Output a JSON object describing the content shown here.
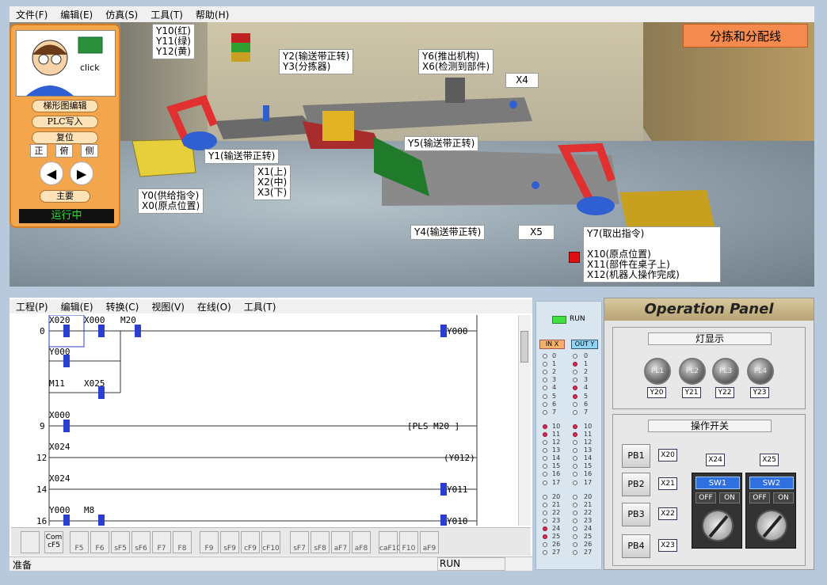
{
  "menu": [
    "文件(F)",
    "编辑(E)",
    "仿真(S)",
    "工具(T)",
    "帮助(H)"
  ],
  "scene": {
    "title": "分拣和分配线",
    "labels": {
      "y10": "Y10(红)\nY11(绿)\nY12(黄)",
      "y2": "Y2(输送带正转)\nY3(分拣器)",
      "y6": "Y6(推出机构)\nX6(检测到部件)",
      "x4": "X4",
      "y1": "Y1(输送带正转)",
      "x1": "X1(上)\nX2(中)\nX3(下)",
      "y0": "Y0(供给指令)\nX0(原点位置)",
      "y5": "Y5(输送带正转)",
      "y4": "Y4(输送带正转)",
      "x5": "X5",
      "y7": "Y7(取出指令)\n\nX10(原点位置)\nX11(部件在桌子上)\nX12(机器人操作完成)"
    }
  },
  "control": {
    "click": "click",
    "buttons": [
      "梯形图编辑",
      "PLC写入",
      "复位"
    ],
    "views": [
      "正",
      "俯",
      "侧"
    ],
    "main": "主要",
    "status": "运行中"
  },
  "editor": {
    "menu": [
      "工程(P)",
      "编辑(E)",
      "转换(C)",
      "视图(V)",
      "在线(O)",
      "工具(T)"
    ],
    "rungs": [
      {
        "step": "0",
        "contacts": [
          "X020",
          "X000",
          "M20"
        ],
        "coil": "Y000"
      },
      {
        "contacts": [
          "Y000"
        ]
      },
      {
        "contacts": [
          "M11",
          "X025"
        ]
      },
      {
        "step": "9",
        "contacts": [
          "X000"
        ],
        "coil": "[PLS   M20  ]"
      },
      {
        "step": "12",
        "contacts": [
          "X024"
        ],
        "coil": "(Y012)"
      },
      {
        "step": "14",
        "contacts": [
          "X024"
        ],
        "coil": "Y011"
      },
      {
        "step": "16",
        "contacts": [
          "Y000",
          "M8"
        ],
        "coil": "Y010"
      }
    ],
    "toolbar": [
      "Com\ncF5",
      "F5",
      "F6",
      "sF5",
      "sF6",
      "F7",
      "F8",
      "F9",
      "sF9",
      "cF9",
      "cF10",
      "sF7",
      "sF8",
      "aF7",
      "aF8",
      "caF10",
      "F10",
      "aF9"
    ],
    "status_left": "准备",
    "status_mid": "RUN"
  },
  "io": {
    "run": "RUN",
    "in": "IN X",
    "out": "OUT Y",
    "rows": [
      "0",
      "1",
      "2",
      "3",
      "4",
      "5",
      "6",
      "7",
      "10",
      "11",
      "12",
      "13",
      "14",
      "15",
      "16",
      "17",
      "20",
      "21",
      "22",
      "23",
      "24",
      "25",
      "26",
      "27"
    ],
    "in_on": [
      "10",
      "11",
      "24",
      "25"
    ],
    "out_on": [
      "1",
      "4",
      "5",
      "10",
      "11"
    ]
  },
  "panel": {
    "title": "Operation Panel",
    "lamp_section": "灯显示",
    "lamps": [
      "PL1",
      "PL2",
      "PL3",
      "PL4"
    ],
    "lamp_outputs": [
      "Y20",
      "Y21",
      "Y22",
      "Y23"
    ],
    "switch_section": "操作开关",
    "pbs": [
      "PB1",
      "PB2",
      "PB3",
      "PB4"
    ],
    "pb_inputs": [
      "X20",
      "X21",
      "X22",
      "X23"
    ],
    "switch_inputs": [
      "X24",
      "X25"
    ],
    "switches": [
      "SW1",
      "SW2"
    ],
    "off": "OFF",
    "on": "ON"
  },
  "colors": {
    "accent": "#f58a4e",
    "run": "#28e028",
    "lamp_on": "#e02850"
  }
}
